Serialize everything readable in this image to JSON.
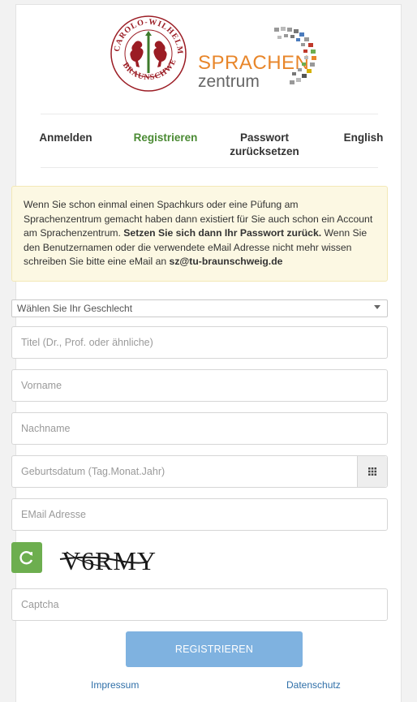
{
  "logo": {
    "seal_text": "CAROLO-WILHELMINA BRAUNSCHWEIG",
    "sprachen": "SPRACHEN",
    "zentrum": "zentrum"
  },
  "nav": {
    "items": [
      {
        "label": "Anmelden"
      },
      {
        "label": "Registrieren",
        "active": true
      },
      {
        "label_line1": "Passwort",
        "label_line2": "zurücksetzen"
      },
      {
        "label": "English"
      }
    ]
  },
  "notice": {
    "text1": "Wenn Sie schon einmal einen Spachkurs oder eine Püfung am Sprachenzentrum gemacht haben dann existiert für Sie auch schon ein Account am Sprachenzentrum. ",
    "bold1": "Setzen Sie sich dann Ihr Passwort zurück.",
    "text2": " Wenn Sie den Benutzernamen oder die verwendete eMail Adresse nicht mehr wissen schreiben Sie bitte eine eMail an ",
    "email": "sz@tu-braunschweig.de"
  },
  "form": {
    "gender_select": "Wählen Sie Ihr Geschlecht",
    "title_placeholder": "Titel (Dr., Prof. oder ähnliche)",
    "firstname_placeholder": "Vorname",
    "lastname_placeholder": "Nachname",
    "birthdate_placeholder": "Geburtsdatum (Tag.Monat.Jahr)",
    "email_placeholder": "EMail Adresse",
    "captcha_text": "V6RMY",
    "captcha_placeholder": "Captcha",
    "submit_label": "REGISTRIEREN"
  },
  "footer": {
    "impressum": "Impressum",
    "datenschutz": "Datenschutz"
  },
  "colors": {
    "accent_green": "#6dae4f",
    "nav_active": "#4a8a33",
    "submit_blue": "#7fb2e0",
    "notice_bg": "#fcf8e3",
    "seal_red": "#9b1c24",
    "sprachen_orange": "#e8862a"
  }
}
